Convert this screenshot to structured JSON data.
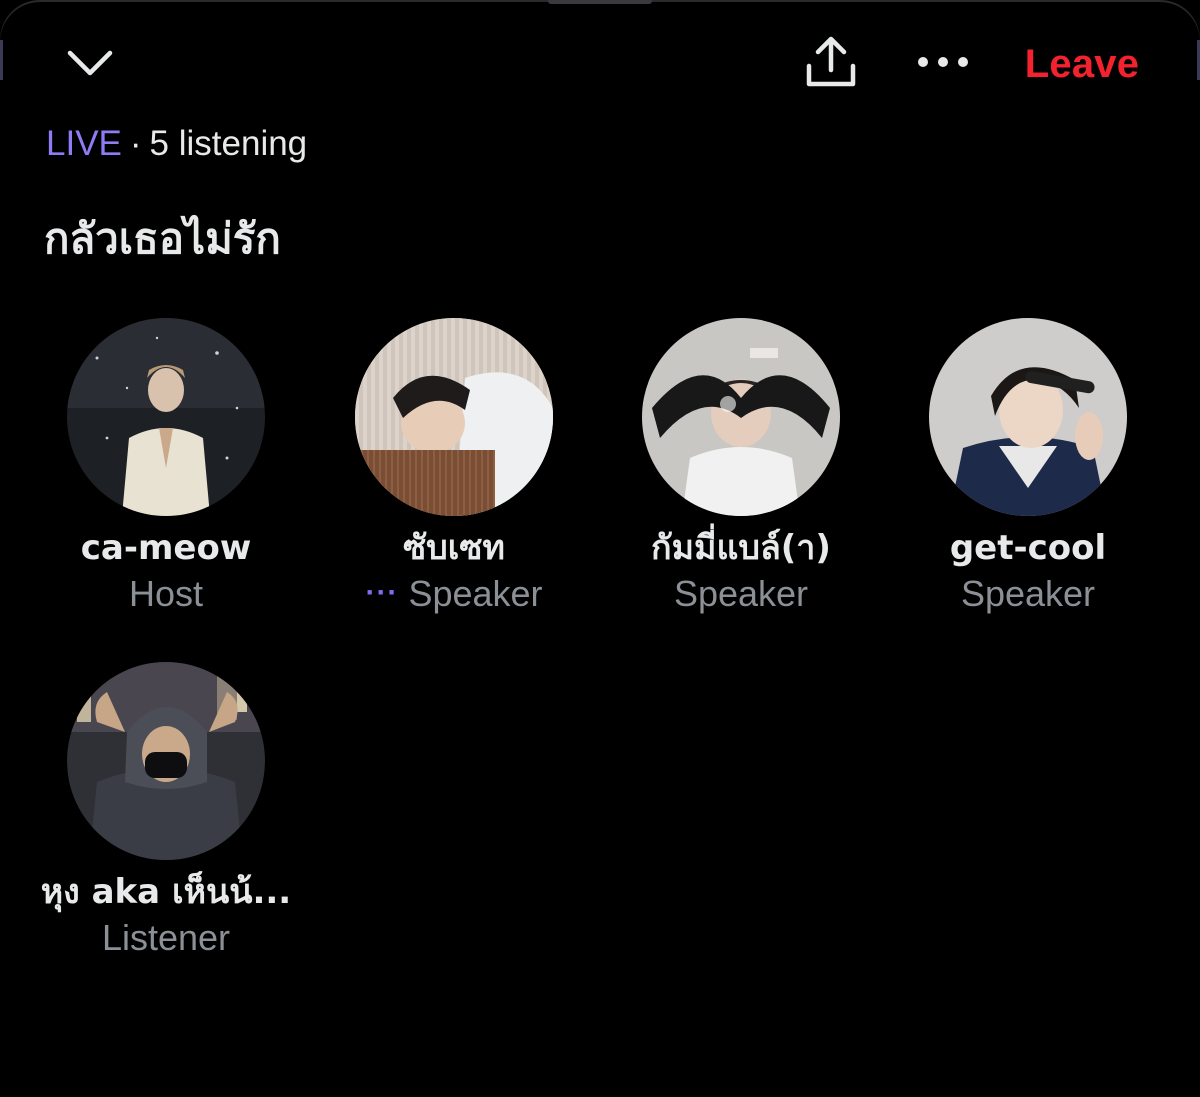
{
  "header": {
    "collapse_icon": "chevron-down-icon",
    "share_icon": "share-icon",
    "more_icon": "more-horizontal-icon",
    "leave_label": "Leave",
    "leave_color": "#f4212e"
  },
  "status": {
    "live_label": "LIVE",
    "separator": "·",
    "listening_text": "5 listening",
    "live_color": "#8f7cf5"
  },
  "space": {
    "title": "กลัวเธอไม่รัก"
  },
  "participants": [
    {
      "name": "ca-meow",
      "role": "Host",
      "speaking": false
    },
    {
      "name": "ซับเซท",
      "role": "Speaker",
      "speaking": true,
      "speaking_indicator": "···"
    },
    {
      "name": "กัมมี่แบล์(า)",
      "role": "Speaker",
      "speaking": false
    },
    {
      "name": "get-cool",
      "role": "Speaker",
      "speaking": false
    },
    {
      "name": "หุง aka เห็นน้...",
      "role": "Listener",
      "speaking": false
    }
  ]
}
